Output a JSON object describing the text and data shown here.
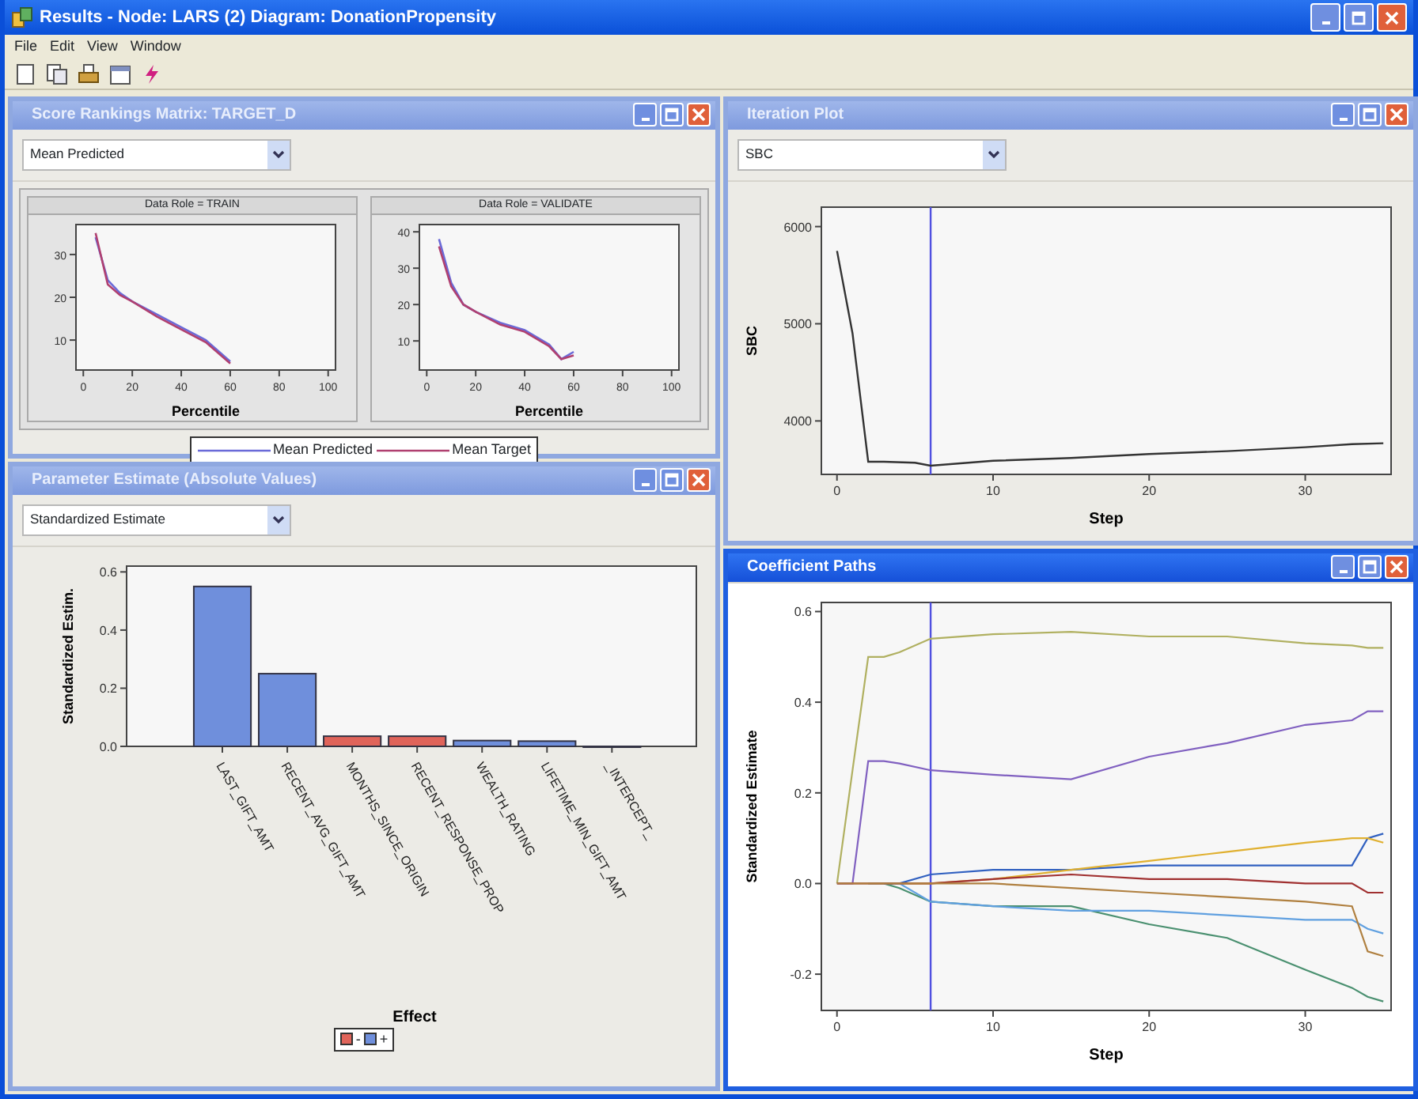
{
  "window": {
    "title": "Results - Node: LARS (2) Diagram: DonationPropensity"
  },
  "menu": [
    "File",
    "Edit",
    "View",
    "Window"
  ],
  "panels": [
    {
      "kind": "score",
      "title": "Score Rankings Matrix: TARGET_D",
      "active": false,
      "dropdown": "Mean Predicted",
      "charts": [
        {
          "chart_data": {
            "type": "line",
            "title": "Data Role = TRAIN",
            "xlabel": "Percentile",
            "x": [
              5,
              10,
              15,
              20,
              30,
              40,
              50,
              60
            ],
            "xlim": [
              -3,
              103
            ],
            "ylim": [
              3,
              37
            ],
            "xticks": [
              0,
              20,
              40,
              60,
              80,
              100
            ],
            "yticks": [
              10,
              20,
              30
            ],
            "series": [
              {
                "color": "#6a6ad8",
                "values": [
                  34,
                  24,
                  21,
                  19,
                  16,
                  13,
                  10,
                  5
                ]
              },
              {
                "color": "#b04070",
                "values": [
                  35,
                  23,
                  20.5,
                  19,
                  15.5,
                  12.5,
                  9.5,
                  4.5
                ]
              }
            ]
          }
        },
        {
          "chart_data": {
            "type": "line",
            "title": "Data Role = VALIDATE",
            "xlabel": "Percentile",
            "x": [
              5,
              10,
              15,
              20,
              30,
              40,
              50,
              55,
              60
            ],
            "xlim": [
              -3,
              103
            ],
            "ylim": [
              2,
              42
            ],
            "xticks": [
              0,
              20,
              40,
              60,
              80,
              100
            ],
            "yticks": [
              10,
              20,
              30,
              40
            ],
            "series": [
              {
                "color": "#6a6ad8",
                "values": [
                  38,
                  26,
                  20,
                  18,
                  15,
                  13,
                  9,
                  5,
                  7
                ]
              },
              {
                "color": "#b04070",
                "values": [
                  36,
                  25,
                  20,
                  18,
                  14.5,
                  12.5,
                  8.5,
                  5,
                  6
                ]
              }
            ]
          }
        }
      ],
      "legend": [
        {
          "label": "Mean Predicted",
          "color": "#6a6ad8"
        },
        {
          "label": "Mean Target",
          "color": "#b04070"
        }
      ]
    },
    {
      "kind": "line",
      "title": "Iteration Plot",
      "active": false,
      "dropdown": "SBC",
      "chart_data": {
        "type": "line",
        "xlabel": "Step",
        "ylabel": "SBC",
        "x": [
          0,
          1,
          2,
          3,
          5,
          6,
          10,
          15,
          20,
          25,
          30,
          33,
          35
        ],
        "xlim": [
          -1,
          35.5
        ],
        "ylim": [
          3450,
          6200
        ],
        "xticks": [
          0,
          10,
          20,
          30
        ],
        "yticks": [
          4000,
          5000,
          6000
        ],
        "ref_lines": [
          {
            "axis": "x",
            "value": 6
          }
        ],
        "series": [
          {
            "color": "#333333",
            "values": [
              5750,
              4900,
              3580,
              3580,
              3570,
              3540,
              3590,
              3620,
              3660,
              3690,
              3730,
              3760,
              3770
            ]
          }
        ]
      }
    },
    {
      "kind": "bar",
      "title": "Parameter Estimate (Absolute Values)",
      "active": false,
      "dropdown": "Standardized Estimate",
      "chart_data": {
        "type": "bar",
        "xlabel": "Effect",
        "ylabel": "Standardized Estim.",
        "categories": [
          "LAST_GIFT_AMT",
          "RECENT_AVG_GIFT_AMT",
          "MONTHS_SINCE_ORIGIN",
          "RECENT_RESPONSE_PROP",
          "WEALTH_RATING",
          "LIFETIME_MIN_GIFT_AMT",
          "_INTERCEPT_"
        ],
        "ylim": [
          0,
          0.62
        ],
        "yticks": [
          {
            "value": 0,
            "label": "0.0"
          },
          {
            "value": 0.2,
            "label": "0.2"
          },
          {
            "value": 0.4,
            "label": "0.4"
          },
          {
            "value": 0.6,
            "label": "0.6"
          }
        ],
        "stacked": true,
        "series": [
          {
            "name": "-",
            "color": "#e0645a",
            "values": [
              null,
              null,
              0.035,
              0.035,
              null,
              null,
              null
            ]
          },
          {
            "name": "+",
            "color": "#6f8fdc",
            "values": [
              0.55,
              0.25,
              null,
              null,
              0.02,
              0.018,
              0
            ]
          }
        ]
      }
    },
    {
      "kind": "line",
      "title": "Coefficient Paths",
      "active": true,
      "chart_data": {
        "type": "line",
        "xlabel": "Step",
        "ylabel": "Standardized Estimate",
        "x": [
          0,
          1,
          2,
          3,
          4,
          6,
          10,
          15,
          20,
          25,
          30,
          33,
          34,
          35
        ],
        "xlim": [
          -1,
          35.5
        ],
        "ylim": [
          -0.28,
          0.62
        ],
        "xticks": [
          0,
          10,
          20,
          30
        ],
        "yticks": [
          {
            "value": -0.2,
            "label": "-0.2"
          },
          {
            "value": 0,
            "label": "0.0"
          },
          {
            "value": 0.2,
            "label": "0.2"
          },
          {
            "value": 0.4,
            "label": "0.4"
          },
          {
            "value": 0.6,
            "label": "0.6"
          }
        ],
        "ref_lines": [
          {
            "axis": "x",
            "value": 6
          }
        ],
        "series": [
          {
            "color": "#b0b060",
            "values": [
              0,
              0.25,
              0.5,
              0.5,
              0.51,
              0.54,
              0.55,
              0.555,
              0.545,
              0.545,
              0.53,
              0.525,
              0.52,
              0.52
            ]
          },
          {
            "color": "#8060c0",
            "values": [
              0,
              0,
              0.27,
              0.27,
              0.265,
              0.25,
              0.24,
              0.23,
              0.28,
              0.31,
              0.35,
              0.36,
              0.38,
              0.38
            ]
          },
          {
            "color": "#4a9070",
            "values": [
              null,
              null,
              0,
              0,
              -0.01,
              -0.04,
              -0.05,
              -0.05,
              -0.09,
              -0.12,
              -0.19,
              -0.23,
              -0.25,
              -0.26
            ]
          },
          {
            "color": "#3060c0",
            "values": [
              null,
              null,
              null,
              0,
              0,
              0.02,
              0.03,
              0.03,
              0.04,
              0.04,
              0.04,
              0.04,
              0.1,
              0.11
            ]
          },
          {
            "color": "#e0b030",
            "values": [
              null,
              null,
              null,
              null,
              0,
              0,
              0.01,
              0.03,
              0.05,
              0.07,
              0.09,
              0.1,
              0.1,
              0.09
            ]
          },
          {
            "color": "#60a0e0",
            "values": [
              null,
              null,
              null,
              0,
              0,
              -0.04,
              -0.05,
              -0.06,
              -0.06,
              -0.07,
              -0.08,
              -0.08,
              -0.1,
              -0.11
            ]
          },
          {
            "color": "#a03030",
            "values": [
              0,
              0,
              0,
              0,
              0,
              0,
              0.01,
              0.02,
              0.01,
              0.01,
              0,
              0,
              -0.02,
              -0.02
            ]
          },
          {
            "color": "#b08040",
            "values": [
              0,
              0,
              0,
              0,
              0,
              0,
              0,
              -0.01,
              -0.02,
              -0.03,
              -0.04,
              -0.05,
              -0.15,
              -0.16
            ]
          }
        ]
      }
    }
  ]
}
